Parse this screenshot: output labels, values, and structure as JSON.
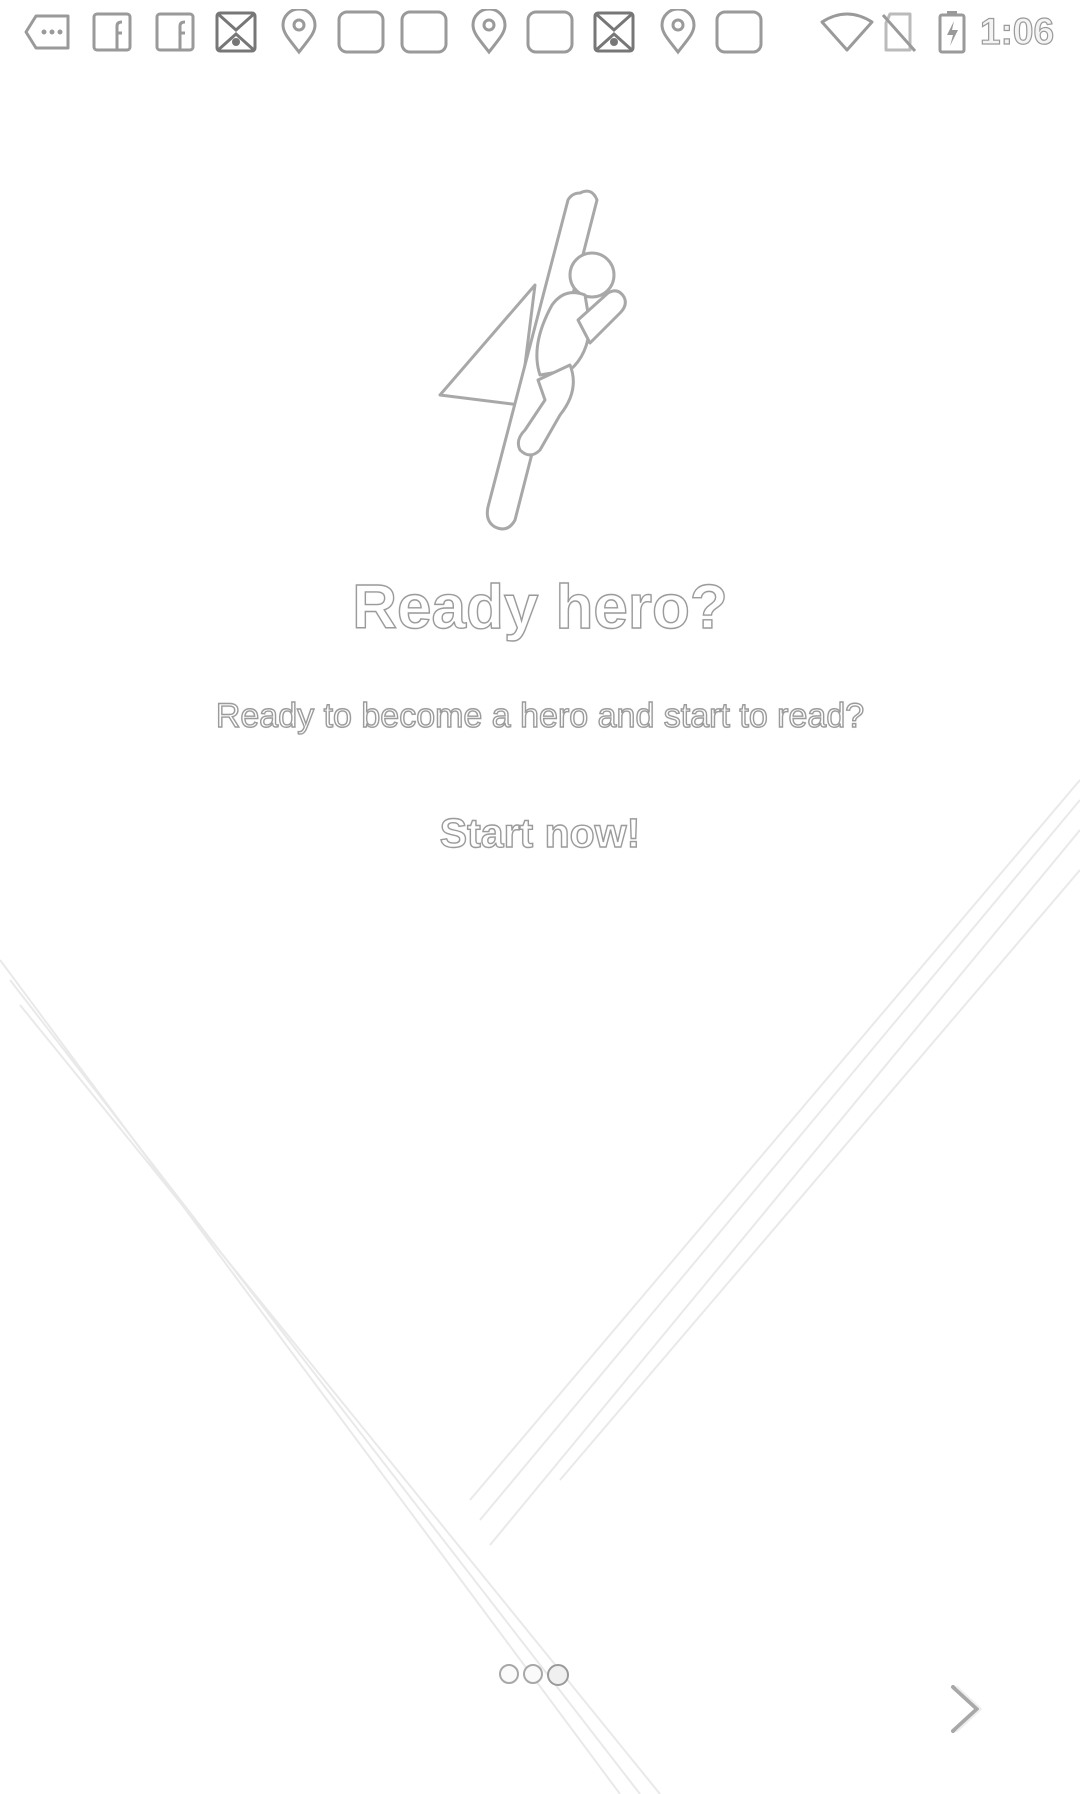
{
  "status_bar": {
    "time": "1:06",
    "notification_icons": [
      "more-icon",
      "facebook-icon",
      "facebook-icon",
      "news-app-icon",
      "location-pin-icon",
      "app-square-icon",
      "app-square-icon",
      "location-pin-icon",
      "app-square-icon",
      "news-app-icon",
      "location-pin-icon",
      "app-square-icon"
    ],
    "system_icons": [
      "wifi-icon",
      "no-sim-icon",
      "battery-charging-icon"
    ]
  },
  "onboarding": {
    "illustration": "flying-superhero-icon",
    "title": "Ready hero?",
    "subtitle": "Ready to become a hero and start to read?",
    "cta_label": "Start now!"
  },
  "pager": {
    "page_count": 3,
    "current_page": 3
  },
  "navigation": {
    "next_icon": "chevron-right-icon"
  }
}
